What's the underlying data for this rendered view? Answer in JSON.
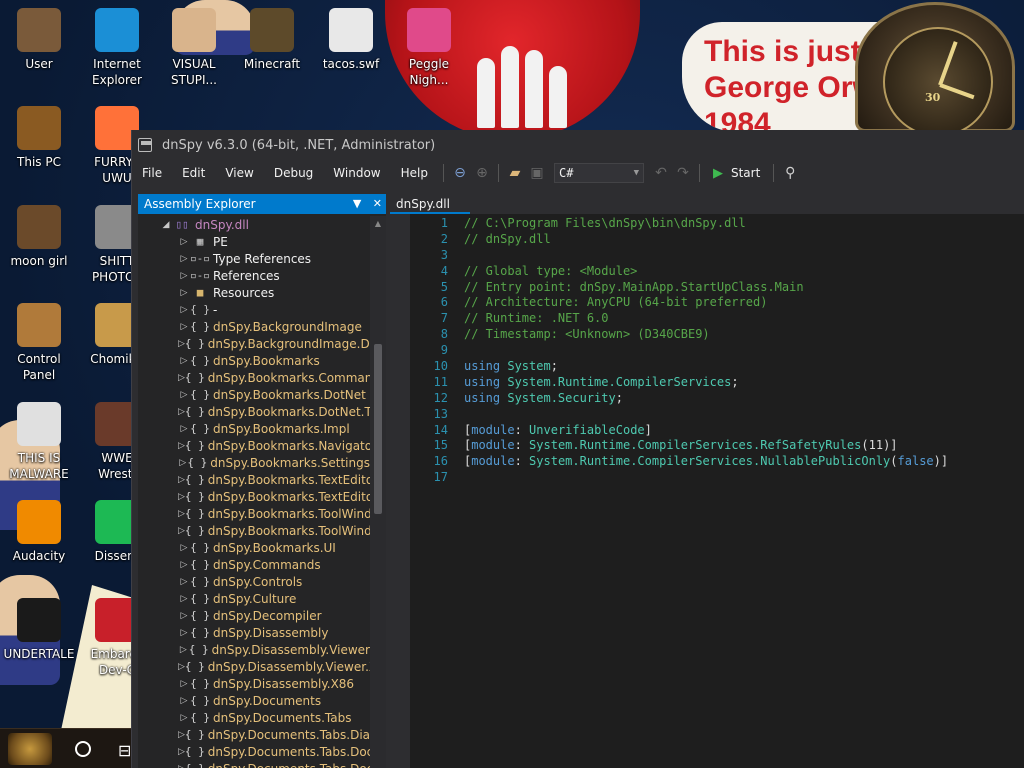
{
  "desktop": {
    "icons": [
      {
        "label": "User",
        "icon": "user-folder-icon",
        "color": "#7a5a3a"
      },
      {
        "label": "Internet\nExplorer",
        "icon": "edge-icon",
        "color": "#1b8fd6"
      },
      {
        "label": "VISUAL\nSTUPI...",
        "icon": "visual-studio-icon",
        "color": "#d9b48c"
      },
      {
        "label": "Minecraft",
        "icon": "minecraft-icon",
        "color": "#5d4a2a"
      },
      {
        "label": "tacos.swf",
        "icon": "flash-file-icon",
        "color": "#e8e8e8"
      },
      {
        "label": "Peggle\nNigh...",
        "icon": "peggle-icon",
        "color": "#e04a8a"
      },
      {
        "label": "This PC",
        "icon": "this-pc-icon",
        "color": "#8a5a22"
      },
      {
        "label": "FURRYF\nUWU",
        "icon": "firefox-icon",
        "color": "#ff7139"
      },
      {
        "label": "moon girl",
        "icon": "moon-girl-icon",
        "color": "#6b4a2a"
      },
      {
        "label": "SHITT\nPHOTOS",
        "icon": "gimp-icon",
        "color": "#8a8a8a"
      },
      {
        "label": "Control Panel",
        "icon": "control-panel-icon",
        "color": "#b07a3a"
      },
      {
        "label": "ChomikB",
        "icon": "chomik-icon",
        "color": "#c89a4a"
      },
      {
        "label": "THIS IS\nMALWARE",
        "icon": "chrome-icon",
        "color": "#e0e0e0"
      },
      {
        "label": "WWE\nWrestl",
        "icon": "wwe-icon",
        "color": "#6a3a2a"
      },
      {
        "label": "Audacity",
        "icon": "audacity-icon",
        "color": "#f08a00"
      },
      {
        "label": "Dissent",
        "icon": "spotify-icon",
        "color": "#1db954"
      },
      {
        "label": "UNDERTALE",
        "icon": "unity-icon",
        "color": "#1a1a1a"
      },
      {
        "label": "Embarca\nDev-C",
        "icon": "devcpp-icon",
        "color": "#c8202a"
      }
    ],
    "wallpaper_text": [
      "This is just",
      "George Orwell's",
      "1984"
    ],
    "clock_numeral": "30"
  },
  "taskbar": {
    "task_view": "⊟"
  },
  "window": {
    "title": "dnSpy v6.3.0 (64-bit, .NET, Administrator)",
    "menu": [
      "File",
      "Edit",
      "View",
      "Debug",
      "Window",
      "Help"
    ],
    "toolbar": {
      "language": "C#",
      "start_label": "Start"
    }
  },
  "explorer": {
    "title": "Assembly Explorer",
    "tree": [
      {
        "level": 0,
        "label": "dnSpy.dll",
        "icon": "▯▯",
        "expander": "◢",
        "kind": "root"
      },
      {
        "level": 1,
        "label": "PE",
        "icon": "▦",
        "expander": "▷",
        "kind": "item"
      },
      {
        "level": 1,
        "label": "Type References",
        "icon": "▫-▫",
        "expander": "▷",
        "kind": "item"
      },
      {
        "level": 1,
        "label": "References",
        "icon": "▫-▫",
        "expander": "▷",
        "kind": "item"
      },
      {
        "level": 1,
        "label": "Resources",
        "icon": "■",
        "expander": "▷",
        "kind": "folder"
      },
      {
        "level": 1,
        "label": "-",
        "icon": "{ }",
        "expander": "▷",
        "kind": "item"
      },
      {
        "level": 1,
        "label": "dnSpy.BackgroundImage",
        "icon": "{ }",
        "expander": "▷",
        "kind": "ns"
      },
      {
        "level": 1,
        "label": "dnSpy.BackgroundImage.Dialogs",
        "icon": "{ }",
        "expander": "▷",
        "kind": "ns"
      },
      {
        "level": 1,
        "label": "dnSpy.Bookmarks",
        "icon": "{ }",
        "expander": "▷",
        "kind": "ns"
      },
      {
        "level": 1,
        "label": "dnSpy.Bookmarks.Commands",
        "icon": "{ }",
        "expander": "▷",
        "kind": "ns"
      },
      {
        "level": 1,
        "label": "dnSpy.Bookmarks.DotNet",
        "icon": "{ }",
        "expander": "▷",
        "kind": "ns"
      },
      {
        "level": 1,
        "label": "dnSpy.Bookmarks.DotNet.TextEditor",
        "icon": "{ }",
        "expander": "▷",
        "kind": "ns"
      },
      {
        "level": 1,
        "label": "dnSpy.Bookmarks.Impl",
        "icon": "{ }",
        "expander": "▷",
        "kind": "ns"
      },
      {
        "level": 1,
        "label": "dnSpy.Bookmarks.Navigator",
        "icon": "{ }",
        "expander": "▷",
        "kind": "ns"
      },
      {
        "level": 1,
        "label": "dnSpy.Bookmarks.Settings",
        "icon": "{ }",
        "expander": "▷",
        "kind": "ns"
      },
      {
        "level": 1,
        "label": "dnSpy.Bookmarks.TextEditor",
        "icon": "{ }",
        "expander": "▷",
        "kind": "ns"
      },
      {
        "level": 1,
        "label": "dnSpy.Bookmarks.TextEditor.Commands",
        "icon": "{ }",
        "expander": "▷",
        "kind": "ns"
      },
      {
        "level": 1,
        "label": "dnSpy.Bookmarks.ToolWindows",
        "icon": "{ }",
        "expander": "▷",
        "kind": "ns"
      },
      {
        "level": 1,
        "label": "dnSpy.Bookmarks.ToolWindows.Bookmarks",
        "icon": "{ }",
        "expander": "▷",
        "kind": "ns"
      },
      {
        "level": 1,
        "label": "dnSpy.Bookmarks.UI",
        "icon": "{ }",
        "expander": "▷",
        "kind": "ns"
      },
      {
        "level": 1,
        "label": "dnSpy.Commands",
        "icon": "{ }",
        "expander": "▷",
        "kind": "ns"
      },
      {
        "level": 1,
        "label": "dnSpy.Controls",
        "icon": "{ }",
        "expander": "▷",
        "kind": "ns"
      },
      {
        "level": 1,
        "label": "dnSpy.Culture",
        "icon": "{ }",
        "expander": "▷",
        "kind": "ns"
      },
      {
        "level": 1,
        "label": "dnSpy.Decompiler",
        "icon": "{ }",
        "expander": "▷",
        "kind": "ns"
      },
      {
        "level": 1,
        "label": "dnSpy.Disassembly",
        "icon": "{ }",
        "expander": "▷",
        "kind": "ns"
      },
      {
        "level": 1,
        "label": "dnSpy.Disassembly.Viewer",
        "icon": "{ }",
        "expander": "▷",
        "kind": "ns"
      },
      {
        "level": 1,
        "label": "dnSpy.Disassembly.Viewer.X86",
        "icon": "{ }",
        "expander": "▷",
        "kind": "ns"
      },
      {
        "level": 1,
        "label": "dnSpy.Disassembly.X86",
        "icon": "{ }",
        "expander": "▷",
        "kind": "ns"
      },
      {
        "level": 1,
        "label": "dnSpy.Documents",
        "icon": "{ }",
        "expander": "▷",
        "kind": "ns"
      },
      {
        "level": 1,
        "label": "dnSpy.Documents.Tabs",
        "icon": "{ }",
        "expander": "▷",
        "kind": "ns"
      },
      {
        "level": 1,
        "label": "dnSpy.Documents.Tabs.Dialogs",
        "icon": "{ }",
        "expander": "▷",
        "kind": "ns"
      },
      {
        "level": 1,
        "label": "dnSpy.Documents.Tabs.DocViewer",
        "icon": "{ }",
        "expander": "▷",
        "kind": "ns"
      },
      {
        "level": 1,
        "label": "dnSpy.Documents.Tabs.DocViewer.ToolTips",
        "icon": "{ }",
        "expander": "▷",
        "kind": "ns"
      }
    ]
  },
  "editor": {
    "tab_label": "dnSpy.dll",
    "lines": [
      [
        {
          "t": "// C:\\Program Files\\dnSpy\\bin\\dnSpy.dll",
          "c": "comment"
        }
      ],
      [
        {
          "t": "// dnSpy.dll",
          "c": "comment"
        }
      ],
      [],
      [
        {
          "t": "// Global type: <Module>",
          "c": "comment"
        }
      ],
      [
        {
          "t": "// Entry point: dnSpy.MainApp.StartUpClass.Main",
          "c": "comment"
        }
      ],
      [
        {
          "t": "// Architecture: AnyCPU (64-bit preferred)",
          "c": "comment"
        }
      ],
      [
        {
          "t": "// Runtime: .NET 6.0",
          "c": "comment"
        }
      ],
      [
        {
          "t": "// Timestamp: <Unknown> (D340CBE9)",
          "c": "comment"
        }
      ],
      [],
      [
        {
          "t": "using",
          "c": "kw"
        },
        {
          "t": " ",
          "c": "plain"
        },
        {
          "t": "System",
          "c": "ns"
        },
        {
          "t": ";",
          "c": "plain"
        }
      ],
      [
        {
          "t": "using",
          "c": "kw"
        },
        {
          "t": " ",
          "c": "plain"
        },
        {
          "t": "System.Runtime.CompilerServices",
          "c": "ns"
        },
        {
          "t": ";",
          "c": "plain"
        }
      ],
      [
        {
          "t": "using",
          "c": "kw"
        },
        {
          "t": " ",
          "c": "plain"
        },
        {
          "t": "System.Security",
          "c": "ns"
        },
        {
          "t": ";",
          "c": "plain"
        }
      ],
      [],
      [
        {
          "t": "[",
          "c": "plain"
        },
        {
          "t": "module",
          "c": "kw"
        },
        {
          "t": ": ",
          "c": "plain"
        },
        {
          "t": "UnverifiableCode",
          "c": "ns"
        },
        {
          "t": "]",
          "c": "plain"
        }
      ],
      [
        {
          "t": "[",
          "c": "plain"
        },
        {
          "t": "module",
          "c": "kw"
        },
        {
          "t": ": ",
          "c": "plain"
        },
        {
          "t": "System.Runtime.CompilerServices.RefSafetyRules",
          "c": "ns"
        },
        {
          "t": "(11)]",
          "c": "plain"
        }
      ],
      [
        {
          "t": "[",
          "c": "plain"
        },
        {
          "t": "module",
          "c": "kw"
        },
        {
          "t": ": ",
          "c": "plain"
        },
        {
          "t": "System.Runtime.CompilerServices.NullablePublicOnly",
          "c": "ns"
        },
        {
          "t": "(",
          "c": "plain"
        },
        {
          "t": "false",
          "c": "kw"
        },
        {
          "t": ")]",
          "c": "plain"
        }
      ],
      []
    ]
  }
}
